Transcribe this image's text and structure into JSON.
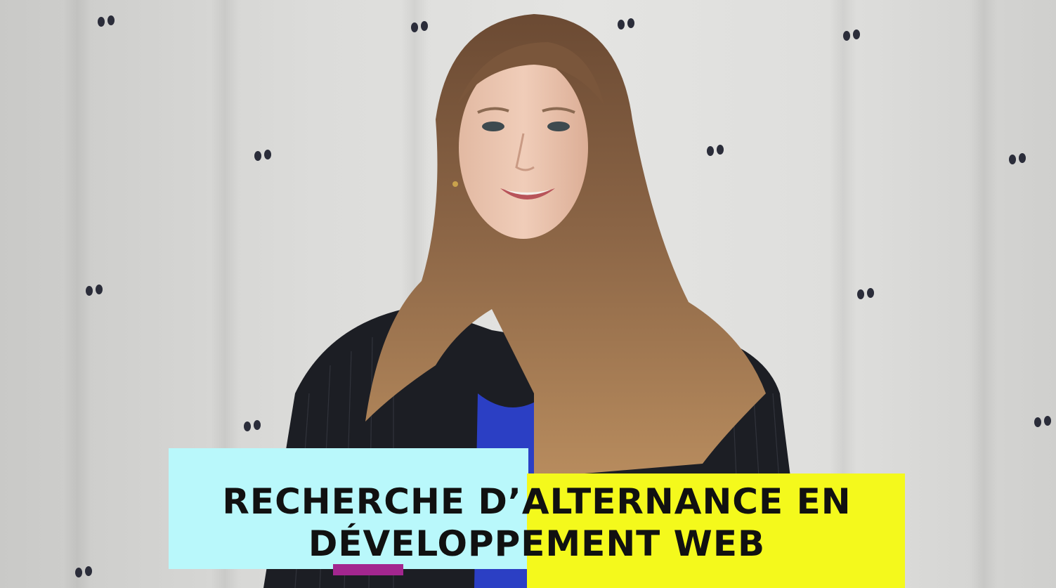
{
  "caption": {
    "line1": "RECHERCHE D’ALTERNANCE EN",
    "line2": "DÉVELOPPEMENT WEB"
  },
  "colors": {
    "banner_cyan": "#b9f8fb",
    "banner_yellow": "#f4f91c",
    "underline_magenta": "#a3268f"
  }
}
